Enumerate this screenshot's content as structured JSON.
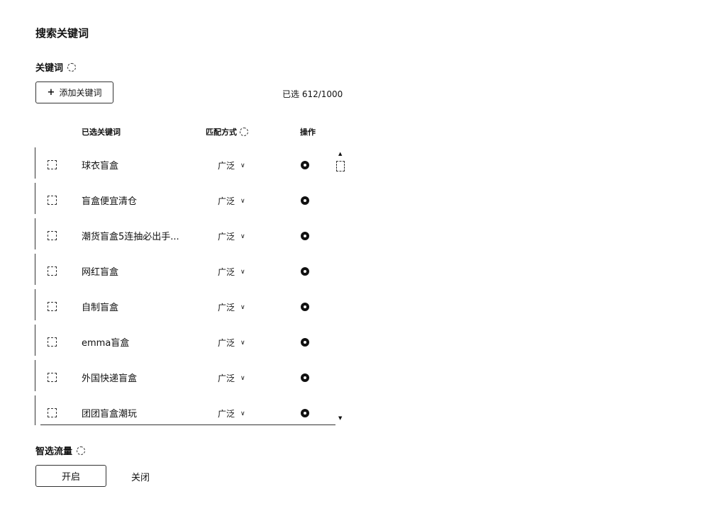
{
  "page": {
    "title": "搜索关键词"
  },
  "keyword_section": {
    "label": "关键词",
    "add_button_label": "添加关键词",
    "selected_count": "已选 612/1000"
  },
  "table": {
    "headers": {
      "keyword": "已选关键词",
      "match": "匹配方式",
      "operation": "操作"
    },
    "rows": [
      {
        "keyword": "球衣盲盒",
        "match": "广泛"
      },
      {
        "keyword": "盲盒便宜清仓",
        "match": "广泛"
      },
      {
        "keyword": "潮货盲盒5连抽必出手...",
        "match": "广泛"
      },
      {
        "keyword": "网红盲盒",
        "match": "广泛"
      },
      {
        "keyword": "自制盲盒",
        "match": "广泛"
      },
      {
        "keyword": "emma盲盒",
        "match": "广泛"
      },
      {
        "keyword": "外国快递盲盒",
        "match": "广泛"
      },
      {
        "keyword": "团团盲盒潮玩",
        "match": "广泛"
      }
    ]
  },
  "smart_traffic": {
    "label": "智选流量",
    "on_label": "开启",
    "off_label": "关闭"
  }
}
